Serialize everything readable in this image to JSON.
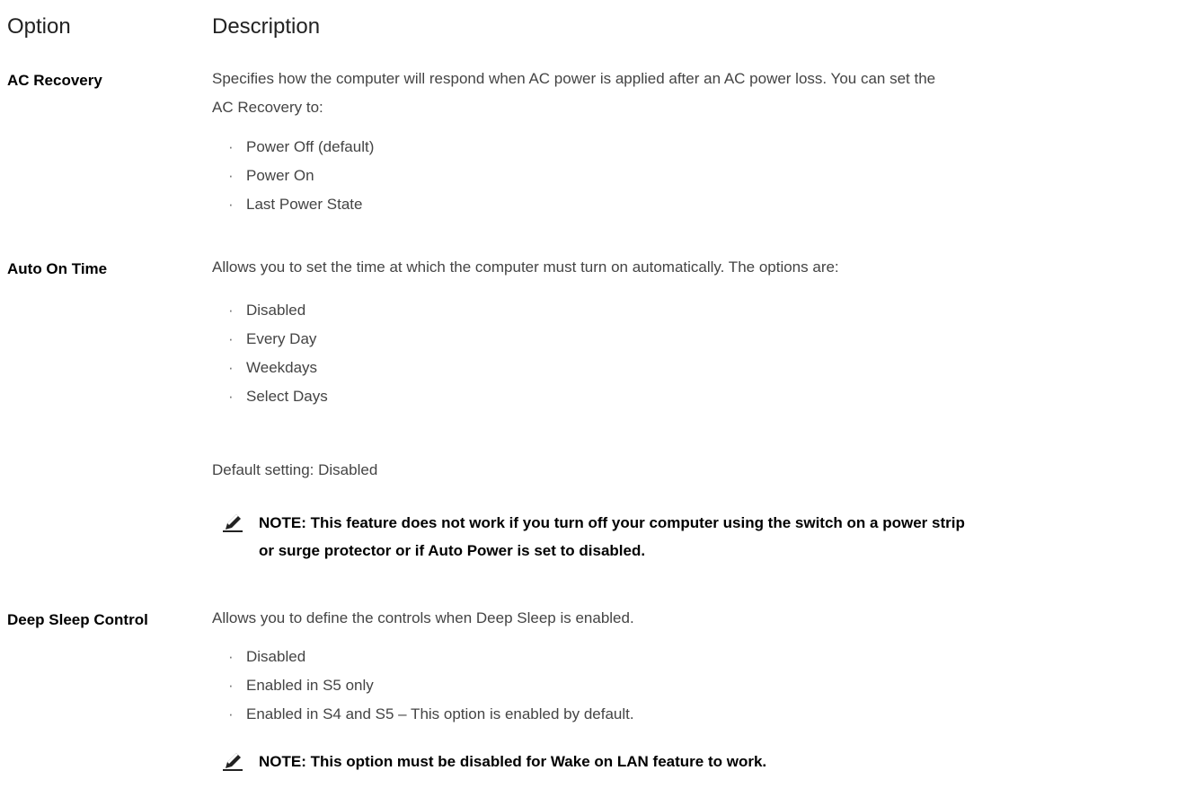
{
  "header": {
    "option": "Option",
    "description": "Description"
  },
  "rows": [
    {
      "label": "AC Recovery",
      "desc_line1": "Specifies how the computer will respond when AC power is applied after an AC power loss. You can set the",
      "desc_line2": "AC Recovery to:",
      "bullets": [
        "Power Off (default)",
        "Power On",
        "Last Power State"
      ]
    },
    {
      "label": "Auto On Time",
      "desc_line1": "Allows you to set the time at which the computer must turn on automatically. The options are:",
      "bullets": [
        "Disabled",
        "Every Day",
        "Weekdays",
        "Select Days"
      ],
      "default_setting": "Default setting: Disabled",
      "note_line1": "NOTE: This feature does not work if you turn off your computer using the switch on a power strip",
      "note_line2": "or surge protector or if Auto Power is set to disabled."
    },
    {
      "label": "Deep Sleep Control",
      "desc_line1": "Allows you to define the controls when Deep Sleep is enabled.",
      "bullets": [
        "Disabled",
        "Enabled in S5 only",
        "Enabled in S4 and S5 – This option is enabled by default."
      ],
      "note_line1": "NOTE: This option must be disabled for Wake on LAN feature to work."
    }
  ],
  "bullet_glyph": "·",
  "note_icon": "pencil-note-icon"
}
